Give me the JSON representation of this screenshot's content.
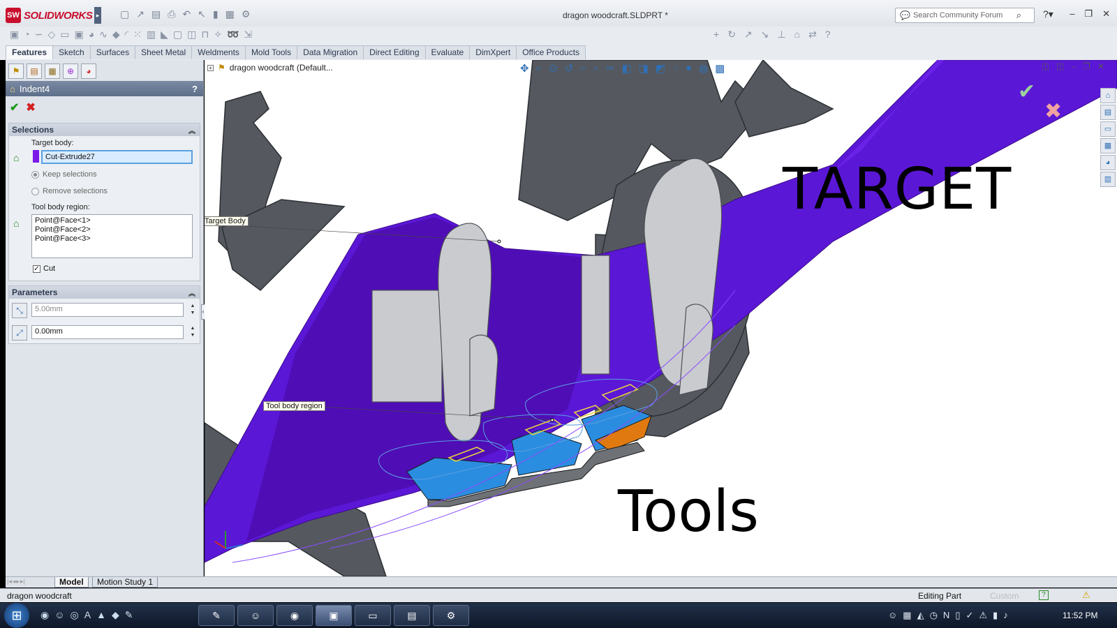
{
  "app": {
    "logo_text": "SOLIDWORKS",
    "logo_mark": "SW",
    "document_title": "dragon woodcraft.SLDPRT *",
    "search_placeholder": "Search Community Forum"
  },
  "command_tabs": [
    "Features",
    "Sketch",
    "Surfaces",
    "Sheet Metal",
    "Weldments",
    "Mold Tools",
    "Data Migration",
    "Direct Editing",
    "Evaluate",
    "DimXpert",
    "Office Products"
  ],
  "active_tab": "Features",
  "property_manager": {
    "feature_name": "Indent4",
    "help_glyph": "?",
    "ok_glyph": "✔",
    "cancel_glyph": "✖",
    "selections": {
      "title": "Selections",
      "target_body_label": "Target body:",
      "target_body_value": "Cut-Extrude27",
      "keep_selections": "Keep selections",
      "remove_selections": "Remove selections",
      "tool_body_region_label": "Tool body region:",
      "tool_body_items": [
        "Point@Face<1>",
        "Point@Face<2>",
        "Point@Face<3>"
      ],
      "cut_label": "Cut",
      "cut_checked": true
    },
    "parameters": {
      "title": "Parameters",
      "thickness": "5.00mm",
      "clearance": "0.00mm"
    }
  },
  "viewport": {
    "tree_root": "dragon woodcraft  (Default...",
    "callout_target": "Target Body",
    "callout_tool": "Tool body region",
    "annotation_target": "TARGET",
    "annotation_tools": "Tools",
    "colors": {
      "target_body": "#5b17d6",
      "target_body_dark": "#4a0aa8",
      "tool_blue": "#2b8de0",
      "tool_orange": "#e07a10",
      "dragon_gray": "#555a60"
    }
  },
  "bottom_tabs": [
    "Model",
    "Motion Study 1"
  ],
  "status": {
    "document_name": "dragon woodcraft",
    "mode": "Editing Part",
    "units": "Custom"
  },
  "taskbar": {
    "clock": "11:52 PM"
  }
}
